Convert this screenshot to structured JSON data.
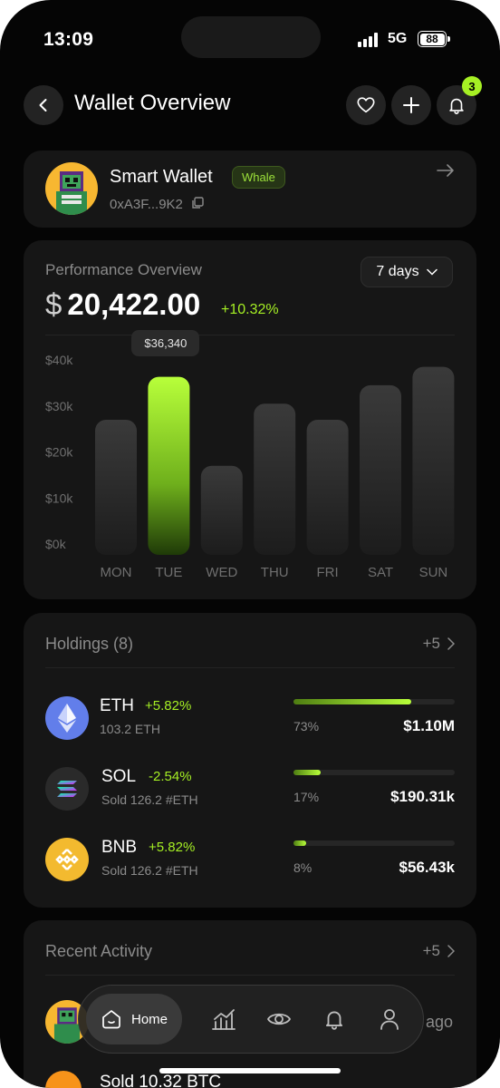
{
  "status_bar": {
    "time": "13:09",
    "network": "5G",
    "battery": "88"
  },
  "header": {
    "title": "Wallet Overview",
    "notification_count": "3"
  },
  "wallet": {
    "name": "Smart Wallet",
    "badge": "Whale",
    "address": "0xA3F...9K2"
  },
  "performance": {
    "label": "Performance Overview",
    "range": "7 days",
    "currency": "$",
    "amount": "20,422.00",
    "change": "+10.32%",
    "tooltip": "$36,340"
  },
  "chart_data": {
    "type": "bar",
    "categories": [
      "MON",
      "TUE",
      "WED",
      "THU",
      "FRI",
      "SAT",
      "SUN"
    ],
    "values": [
      27000,
      36340,
      17000,
      30500,
      27000,
      34500,
      38500
    ],
    "highlight_index": 1,
    "ytick_labels": [
      "$40k",
      "$30k",
      "$20k",
      "$10k",
      "$0k"
    ],
    "ylim": [
      0,
      40000
    ]
  },
  "holdings": {
    "title": "Holdings (8)",
    "more": "+5",
    "items": [
      {
        "symbol": "ETH",
        "change": "+5.82%",
        "sub": "103.2 ETH",
        "percent": "73%",
        "share": 0.73,
        "value": "$1.10M",
        "icon": "ethereum-icon",
        "color": "#627eea"
      },
      {
        "symbol": "SOL",
        "change": "-2.54%",
        "sub": "Sold 126.2 #ETH",
        "percent": "17%",
        "share": 0.17,
        "value": "$190.31k",
        "icon": "solana-icon",
        "color": "#2a2a2a"
      },
      {
        "symbol": "BNB",
        "change": "+5.82%",
        "sub": "Sold 126.2 #ETH",
        "percent": "8%",
        "share": 0.08,
        "value": "$56.43k",
        "icon": "bnb-icon",
        "color": "#f3ba2f"
      }
    ]
  },
  "activity": {
    "title": "Recent Activity",
    "more": "+5",
    "items": [
      {
        "text": "ago"
      },
      {
        "text": "Sold 10.32 BTC"
      }
    ]
  },
  "nav": {
    "home_label": "Home"
  }
}
